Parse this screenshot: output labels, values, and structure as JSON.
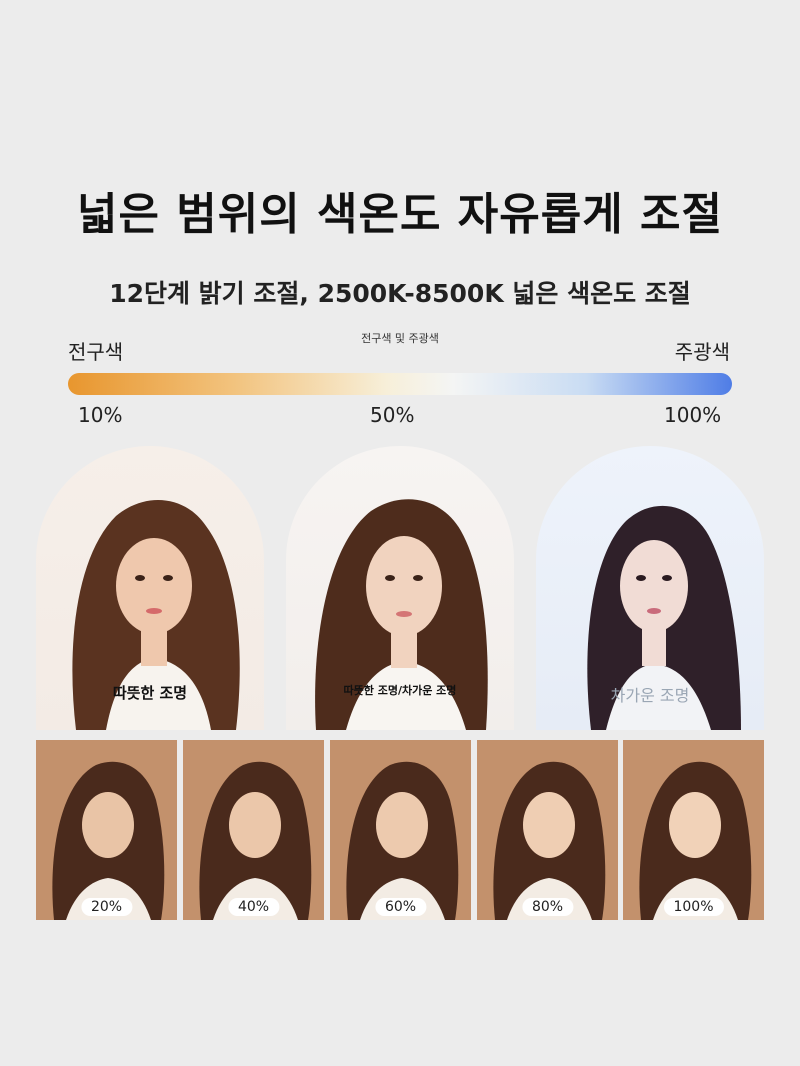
{
  "header": {
    "title": "넓은 범위의 색온도 자유롭게 조절",
    "subtitle": "12단계 밝기 조절, 2500K-8500K 넓은 색온도 조절"
  },
  "scale": {
    "left_label": "전구색",
    "middle_label": "전구색 및 주광색",
    "right_label": "주광색",
    "ticks": [
      "10%",
      "50%",
      "100%"
    ],
    "gradient_colors": [
      "#e8962e",
      "#f7efd9",
      "#4f7de6"
    ]
  },
  "arches": [
    {
      "caption": "따뜻한 조명",
      "tone": "warm"
    },
    {
      "caption": "따뜻한 조명/차가운 조명",
      "tone": "neutral"
    },
    {
      "caption": "차가운 조명",
      "tone": "cool"
    }
  ],
  "thumbnails": [
    {
      "label": "20%"
    },
    {
      "label": "40%"
    },
    {
      "label": "60%"
    },
    {
      "label": "80%"
    },
    {
      "label": "100%"
    }
  ],
  "colors": {
    "background": "#ececec",
    "thumb_background": "#c3916c",
    "hair": "#4a2a1c"
  }
}
